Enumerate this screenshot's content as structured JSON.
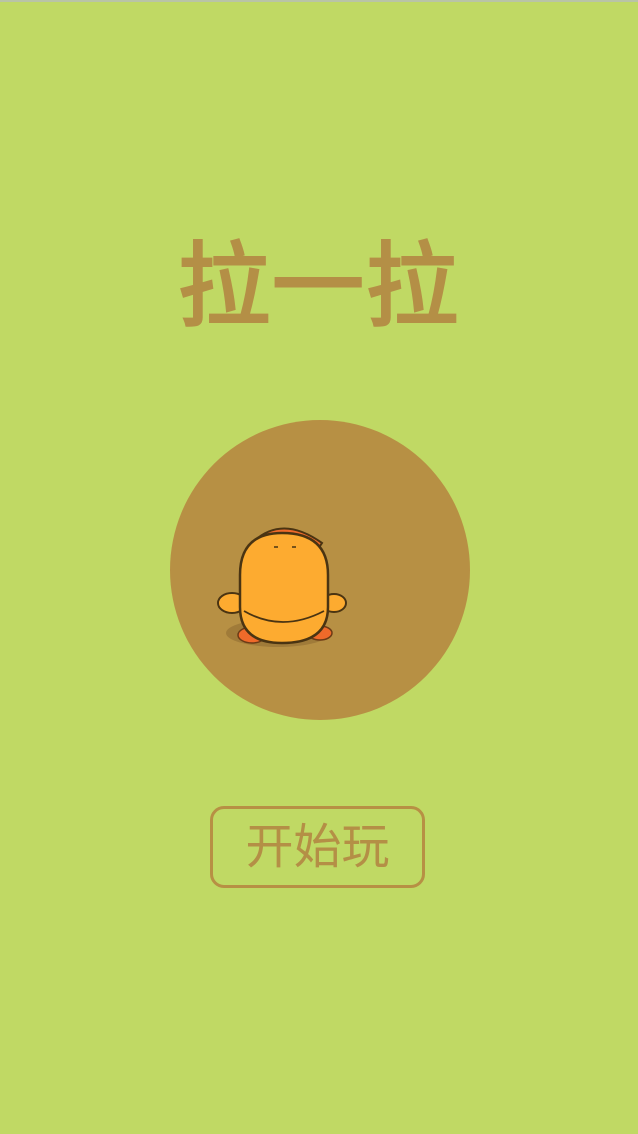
{
  "game": {
    "title": "拉一拉",
    "start_button_label": "开始玩"
  },
  "colors": {
    "background": "#c0d964",
    "accent": "#b48f46",
    "stage": "#b79044",
    "duck_body": "#fdab30",
    "duck_feet": "#ef6a2a"
  },
  "icons": {
    "character": "duck-icon"
  }
}
